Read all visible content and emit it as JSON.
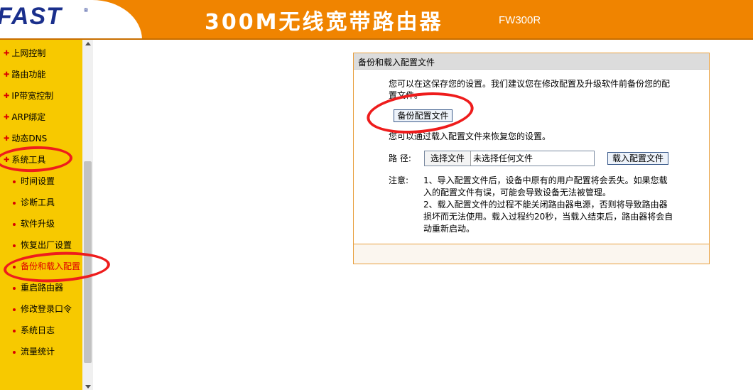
{
  "header": {
    "logo": "FAST",
    "logo_mark": "®",
    "title": "300M无线宽带路由器",
    "model": "FW300R"
  },
  "sidebar": {
    "items": [
      {
        "label": "上网控制",
        "level": 1
      },
      {
        "label": "路由功能",
        "level": 1
      },
      {
        "label": "IP带宽控制",
        "level": 1
      },
      {
        "label": "ARP绑定",
        "level": 1
      },
      {
        "label": "动态DNS",
        "level": 1
      },
      {
        "label": "系统工具",
        "level": 1,
        "expanded": true
      },
      {
        "label": "时间设置",
        "level": 2
      },
      {
        "label": "诊断工具",
        "level": 2
      },
      {
        "label": "软件升级",
        "level": 2
      },
      {
        "label": "恢复出厂设置",
        "level": 2
      },
      {
        "label": "备份和载入配置",
        "level": 2,
        "active": true
      },
      {
        "label": "重启路由器",
        "level": 2
      },
      {
        "label": "修改登录口令",
        "level": 2
      },
      {
        "label": "系统日志",
        "level": 2
      },
      {
        "label": "流量统计",
        "level": 2
      }
    ]
  },
  "panel": {
    "title": "备份和载入配置文件",
    "backup_desc_line1": "您可以在这保存您的设置。我们建议您在修改配置及升级软件前备份您的配",
    "backup_desc_line2": "置文件。",
    "backup_button": "备份配置文件",
    "restore_desc": "您可以通过载入配置文件来恢复您的设置。",
    "path_label": "路 径:",
    "choose_file_button": "选择文件",
    "file_status": "未选择任何文件",
    "load_button": "载入配置文件",
    "note_label": "注意:",
    "notes": [
      "1、导入配置文件后，设备中原有的用户配置将会丢失。如果您载",
      "入的配置文件有误，可能会导致设备无法被管理。",
      "2、载入配置文件的过程不能关闭路由器电源，否则将导致路由器",
      "损坏而无法使用。载入过程约20秒，当载入结束后，路由器将会自",
      "动重新启动。"
    ]
  },
  "colors": {
    "header_orange": "#f08400",
    "sidebar_yellow": "#f7c900",
    "accent_red": "#e00000",
    "annotation_red": "#ee1c1c",
    "logo_blue": "#1a2f8c"
  }
}
